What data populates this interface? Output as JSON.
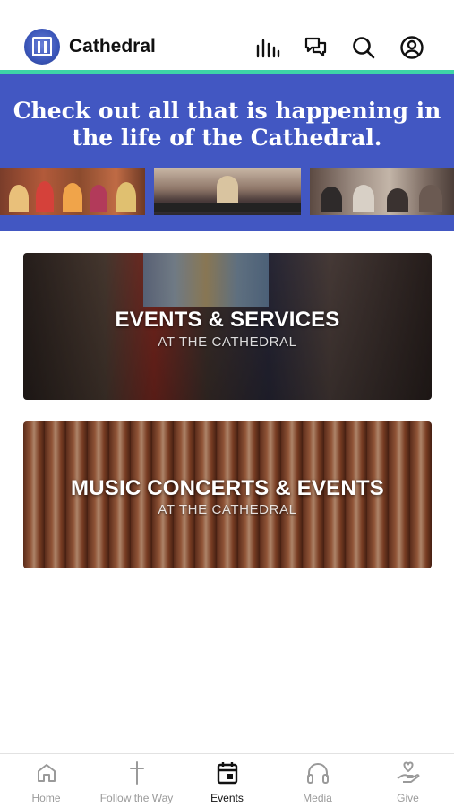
{
  "header": {
    "app_title": "Cathedral",
    "icons": [
      "logo-icon",
      "audio-bars-icon",
      "chat-icon",
      "search-icon",
      "account-icon"
    ]
  },
  "colors": {
    "accent": "#3ed5a7",
    "banner": "#4257c2",
    "tab_active": "#111111",
    "tab_inactive": "#9a9a9a"
  },
  "banner": {
    "headline": "Check out all that is happening in the life of the Cathedral."
  },
  "cards": [
    {
      "title": "EVENTS & SERVICES",
      "subtitle": "AT THE CATHEDRAL"
    },
    {
      "title": "MUSIC CONCERTS & EVENTS",
      "subtitle": "AT THE CATHEDRAL"
    }
  ],
  "tabs": [
    {
      "label": "Home",
      "icon": "home-icon",
      "active": false
    },
    {
      "label": "Follow the Way",
      "icon": "cross-icon",
      "active": false
    },
    {
      "label": "Events",
      "icon": "calendar-icon",
      "active": true
    },
    {
      "label": "Media",
      "icon": "headphones-icon",
      "active": false
    },
    {
      "label": "Give",
      "icon": "give-hand-icon",
      "active": false
    }
  ]
}
